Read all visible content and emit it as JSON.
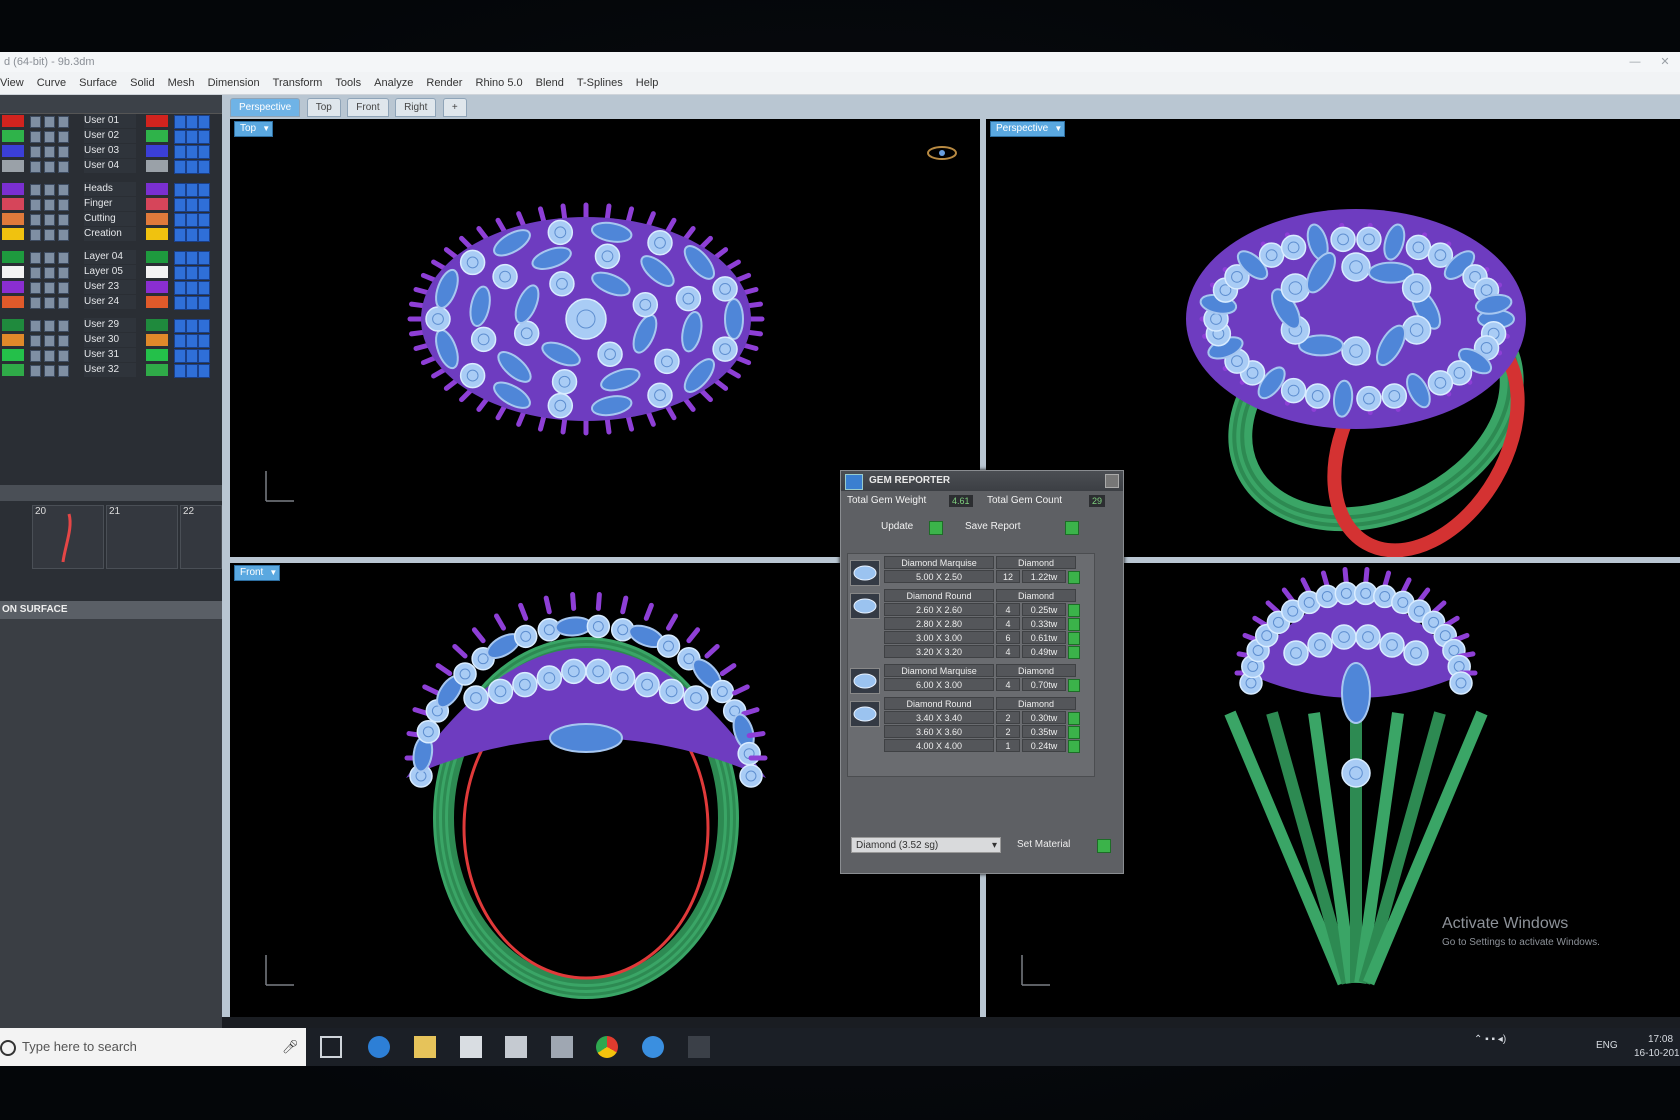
{
  "window": {
    "title": "d (64-bit) - 9b.3dm"
  },
  "menu": [
    "View",
    "Curve",
    "Surface",
    "Solid",
    "Mesh",
    "Dimension",
    "Transform",
    "Tools",
    "Analyze",
    "Render",
    "Rhino 5.0",
    "Blend",
    "T-Splines",
    "Help"
  ],
  "tabs": [
    "Perspective",
    "Top",
    "Front",
    "Right"
  ],
  "viewports": {
    "top": "Top",
    "perspective": "Perspective",
    "front": "Front"
  },
  "layers": [
    {
      "name": "User 01",
      "color": "#d2231e"
    },
    {
      "name": "User 02",
      "color": "#2fb34a"
    },
    {
      "name": "User 03",
      "color": "#3b3fd8"
    },
    {
      "name": "User 04",
      "color": "#9aa1a8"
    },
    {
      "name": "Heads",
      "color": "#7a2fd0"
    },
    {
      "name": "Finger",
      "color": "#d6455a"
    },
    {
      "name": "Cutting",
      "color": "#e07a3b"
    },
    {
      "name": "Creation",
      "color": "#f0c20f"
    },
    {
      "name": "Layer 04",
      "color": "#1e9a3e"
    },
    {
      "name": "Layer 05",
      "color": "#f3f3f3"
    },
    {
      "name": "User 23",
      "color": "#8a2ed0"
    },
    {
      "name": "User 24",
      "color": "#e05a2a"
    },
    {
      "name": "User 29",
      "color": "#1f8a3d"
    },
    {
      "name": "User 30",
      "color": "#e0892a"
    },
    {
      "name": "User 31",
      "color": "#24c04a"
    },
    {
      "name": "User 32",
      "color": "#2faa48"
    }
  ],
  "thumbs": [
    "20",
    "21",
    "22"
  ],
  "surface_panel": "ON SURFACE",
  "gem_reporter": {
    "title": "GEM REPORTER",
    "total_weight_label": "Total Gem Weight",
    "total_weight_value": "4.61",
    "total_count_label": "Total Gem Count",
    "total_count_value": "29",
    "update_label": "Update",
    "save_label": "Save Report",
    "groups": [
      {
        "shape": "Diamond Marquise",
        "material": "Diamond",
        "rows": [
          [
            "5.00 X 2.50",
            "12",
            "1.22tw"
          ]
        ]
      },
      {
        "shape": "Diamond Round",
        "material": "Diamond",
        "rows": [
          [
            "2.60 X 2.60",
            "4",
            "0.25tw"
          ],
          [
            "2.80 X 2.80",
            "4",
            "0.33tw"
          ],
          [
            "3.00 X 3.00",
            "6",
            "0.61tw"
          ],
          [
            "3.20 X 3.20",
            "4",
            "0.49tw"
          ]
        ]
      },
      {
        "shape": "Diamond Marquise",
        "material": "Diamond",
        "rows": [
          [
            "6.00 X 3.00",
            "4",
            "0.70tw"
          ]
        ]
      },
      {
        "shape": "Diamond Round",
        "material": "Diamond",
        "rows": [
          [
            "3.40 X 3.40",
            "2",
            "0.30tw"
          ],
          [
            "3.60 X 3.60",
            "2",
            "0.35tw"
          ],
          [
            "4.00 X 4.00",
            "1",
            "0.24tw"
          ]
        ]
      }
    ],
    "material_select": "Diamond    (3.52 sg)",
    "set_material_label": "Set Material"
  },
  "watermark": {
    "title": "Activate Windows",
    "subtitle": "Go to Settings to activate Windows."
  },
  "taskbar": {
    "search_placeholder": "Type here to search",
    "lang": "ENG",
    "time": "17:08",
    "date": "16-10-201"
  }
}
